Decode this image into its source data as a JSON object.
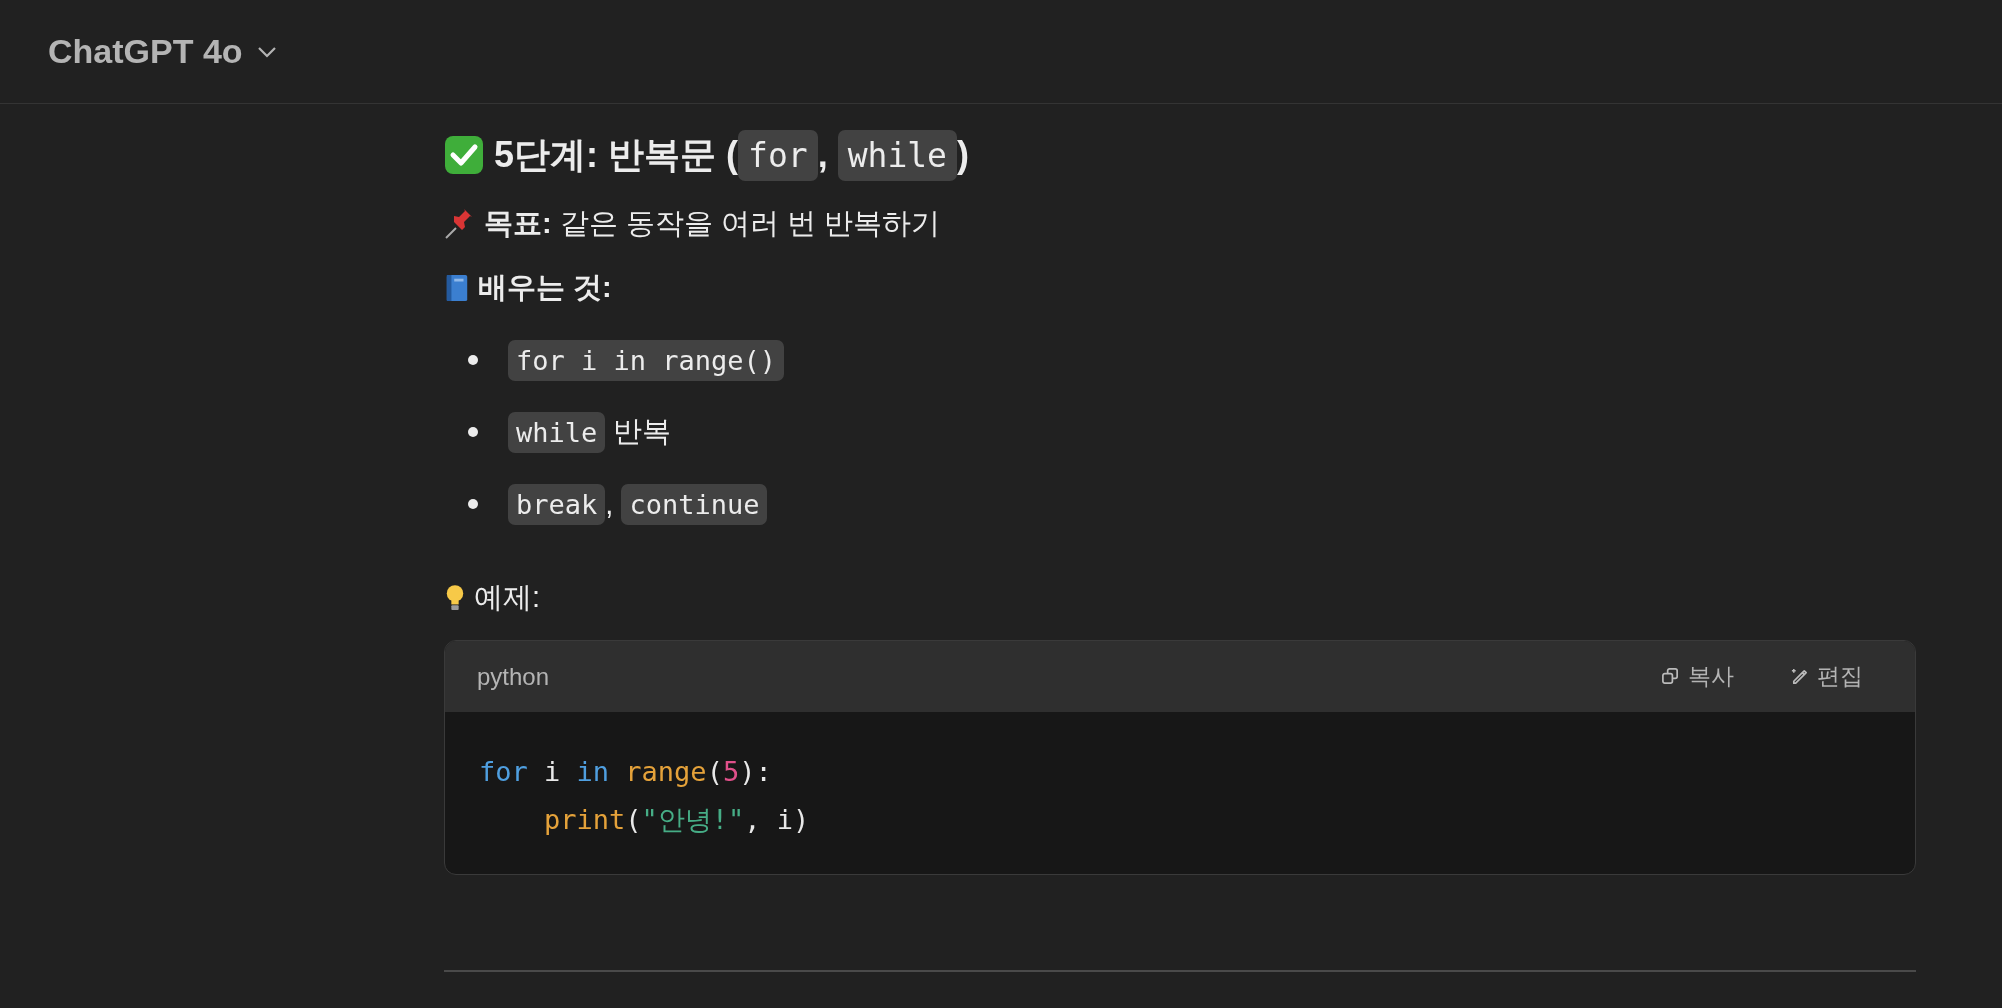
{
  "header": {
    "model": "ChatGPT 4o"
  },
  "heading": [
    {
      "kind": "text",
      "text": "5단계: 반복문 ("
    },
    {
      "kind": "code",
      "text": "for"
    },
    {
      "kind": "text",
      "text": ", "
    },
    {
      "kind": "code",
      "text": "while"
    },
    {
      "kind": "text",
      "text": ")"
    }
  ],
  "goal": {
    "label": "목표:",
    "text": "같은 동작을 여러 번 반복하기"
  },
  "learn": {
    "label": "배우는 것:"
  },
  "bullets": [
    [
      {
        "kind": "code",
        "text": "for i in range()"
      }
    ],
    [
      {
        "kind": "code",
        "text": "while"
      },
      {
        "kind": "text",
        "text": " 반복"
      }
    ],
    [
      {
        "kind": "code",
        "text": "break"
      },
      {
        "kind": "text",
        "text": ", "
      },
      {
        "kind": "code",
        "text": "continue"
      }
    ]
  ],
  "example": {
    "label": "예제:"
  },
  "code_block": {
    "language": "python",
    "buttons": [
      {
        "kind": "copy",
        "label": "복사"
      },
      {
        "kind": "edit",
        "label": "편집"
      }
    ],
    "lines": [
      {
        "indent": false,
        "tokens": [
          {
            "kind": "keyword",
            "text": "for"
          },
          {
            "kind": "plain",
            "text": " i "
          },
          {
            "kind": "keyword",
            "text": "in "
          },
          {
            "kind": "func",
            "text": "range"
          },
          {
            "kind": "plain",
            "text": "("
          },
          {
            "kind": "number",
            "text": "5"
          },
          {
            "kind": "plain",
            "text": "):"
          }
        ]
      },
      {
        "indent": true,
        "tokens": [
          {
            "kind": "func",
            "text": "print"
          },
          {
            "kind": "plain",
            "text": "("
          },
          {
            "kind": "string",
            "text": "\"안녕!\""
          },
          {
            "kind": "plain",
            "text": ", i)"
          }
        ]
      }
    ]
  }
}
